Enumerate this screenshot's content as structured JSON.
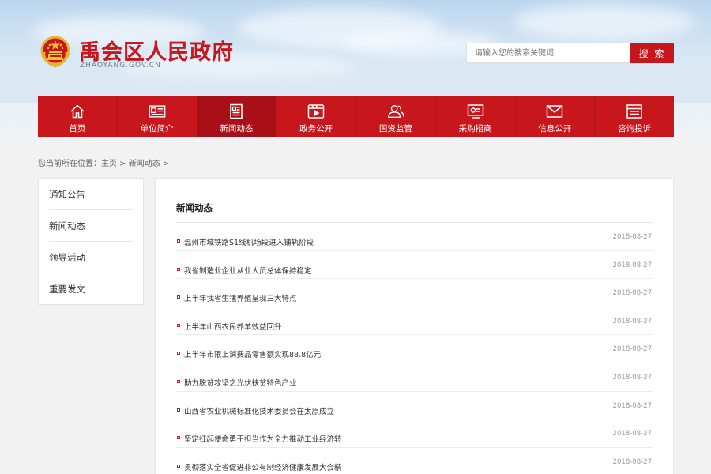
{
  "header": {
    "site_title": "禹会区人民政府",
    "site_domain": "ZHAOYANG.GOV.CN",
    "search_placeholder": "请输入您的搜索关键词",
    "search_button": "搜 索"
  },
  "nav": {
    "items": [
      {
        "label": "首页",
        "icon": "home-icon"
      },
      {
        "label": "单位简介",
        "icon": "id-card-icon"
      },
      {
        "label": "新闻动态",
        "icon": "news-icon",
        "active": true
      },
      {
        "label": "政务公开",
        "icon": "video-icon"
      },
      {
        "label": "国资监管",
        "icon": "people-icon"
      },
      {
        "label": "采购招商",
        "icon": "monitor-icon"
      },
      {
        "label": "信息公开",
        "icon": "mail-icon"
      },
      {
        "label": "咨询投诉",
        "icon": "document-icon"
      }
    ]
  },
  "breadcrumb": {
    "prefix": "您当前所在位置：",
    "home": "主页",
    "sep1": " > ",
    "current": "新闻动态",
    "sep2": " >"
  },
  "sidebar": {
    "items": [
      {
        "label": "通知公告"
      },
      {
        "label": "新闻动态"
      },
      {
        "label": "领导活动"
      },
      {
        "label": "重要发文"
      }
    ]
  },
  "main": {
    "title": "新闻动态",
    "news": [
      {
        "title": "温州市域铁路S1线机场段进入铺轨阶段",
        "date": "2018-08-27"
      },
      {
        "title": "我省制造业企业从业人员总体保持稳定",
        "date": "2018-08-27"
      },
      {
        "title": "上半年我省生猪养殖呈现三大特点",
        "date": "2018-08-27"
      },
      {
        "title": "上半年山西农民养羊效益回升",
        "date": "2018-08-27"
      },
      {
        "title": "上半年市限上消费品零售额实现88.8亿元",
        "date": "2018-08-27"
      },
      {
        "title": "助力脱贫攻坚之光伏扶贫特色产业",
        "date": "2018-08-27"
      },
      {
        "title": "山西省农业机械标准化技术委员会在太原成立",
        "date": "2018-08-27"
      },
      {
        "title": "坚定扛起使命勇于担当作为全力推动工业经济转",
        "date": "2018-08-27"
      },
      {
        "title": "贯彻落实全省促进非公有制经济健康发展大会精",
        "date": "2018-08-27"
      }
    ]
  },
  "colors": {
    "brand_red": "#c8161d",
    "nav_active": "#a80f16",
    "page_bg": "#f2f2f2"
  }
}
